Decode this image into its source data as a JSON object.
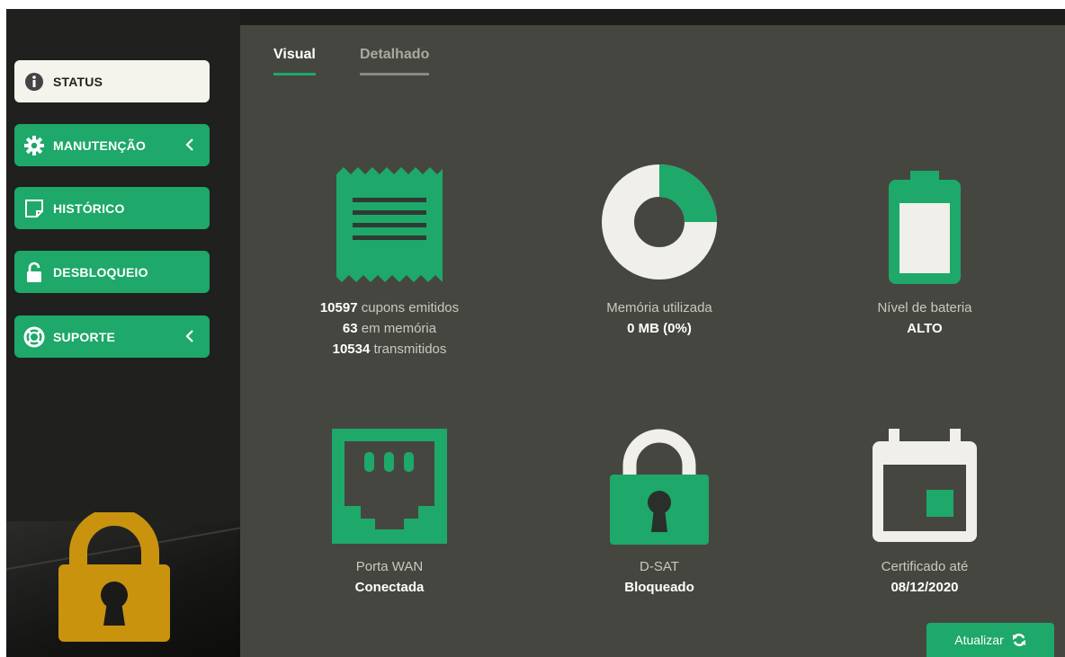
{
  "sidebar": {
    "items": [
      {
        "label": "STATUS",
        "icon": "info-icon"
      },
      {
        "label": "MANUTENÇÃO",
        "icon": "gear-icon",
        "has_chevron": true
      },
      {
        "label": "HISTÓRICO",
        "icon": "note-icon"
      },
      {
        "label": "DESBLOQUEIO",
        "icon": "unlock-icon"
      },
      {
        "label": "SUPORTE",
        "icon": "lifebuoy-icon",
        "has_chevron": true
      }
    ],
    "lock_status_icon": "padlock-icon"
  },
  "tabs": [
    {
      "label": "Visual",
      "active": true
    },
    {
      "label": "Detalhado",
      "active": false
    }
  ],
  "status": {
    "cupons": {
      "emitidos_value": "10597",
      "emitidos_label": "cupons emitidos",
      "memoria_value": "63",
      "memoria_label": "em memória",
      "transmitidos_value": "10534",
      "transmitidos_label": "transmitidos"
    },
    "memoria": {
      "label": "Memória utilizada",
      "value": "0 MB (0%)",
      "donut_fraction_shown": 0.25
    },
    "bateria": {
      "label": "Nível de bateria",
      "value": "ALTO"
    },
    "wan": {
      "label": "Porta WAN",
      "value": "Conectada"
    },
    "dsat": {
      "label": "D-SAT",
      "value": "Bloqueado"
    },
    "certificado": {
      "label": "Certificado até",
      "value": "08/12/2020"
    }
  },
  "refresh_button": {
    "label": "Atualizar",
    "icon": "refresh-icon"
  },
  "colors": {
    "accent": "#1ea86a",
    "panel": "#464640",
    "sidebar": "#20201e",
    "light": "#f0efe9",
    "lock_gold": "#c9930e"
  }
}
